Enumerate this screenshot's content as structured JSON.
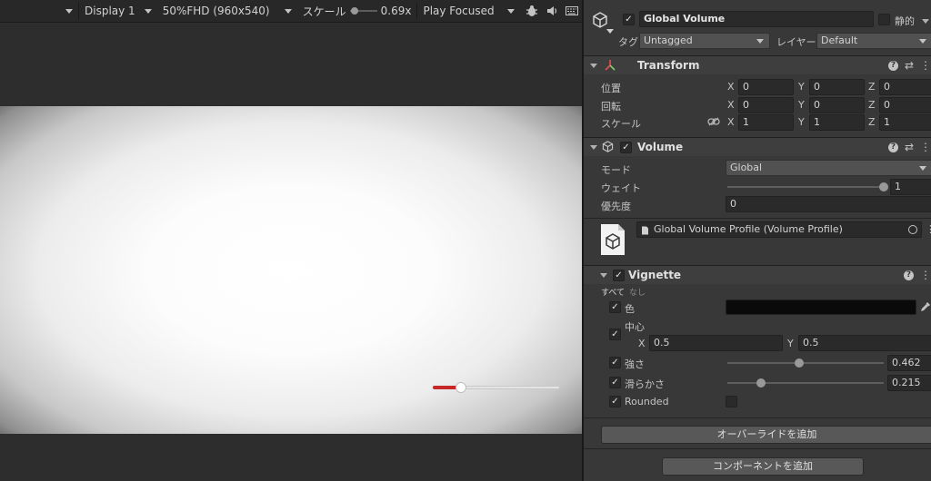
{
  "game_toolbar": {
    "display": "Display 1",
    "resolution": "50%FHD (960x540)",
    "scale_label": "スケール",
    "scale_value": "0.69x",
    "play_mode": "Play Focused",
    "icons": [
      "bug-icon",
      "speaker-icon",
      "keyboard-icon"
    ]
  },
  "game_view": {
    "health_bar_fill_fraction": 0.22,
    "health_bar_color": "#c62828"
  },
  "object_header": {
    "name": "Global Volume",
    "enabled": true,
    "static_label": "静的",
    "static": false,
    "tag_label": "タグ",
    "tag_value": "Untagged",
    "layer_label": "レイヤー",
    "layer_value": "Default"
  },
  "transform": {
    "title": "Transform",
    "position_label": "位置",
    "rotation_label": "回転",
    "scale_label": "スケール",
    "axes": [
      "X",
      "Y",
      "Z"
    ],
    "position": [
      "0",
      "0",
      "0"
    ],
    "rotation": [
      "0",
      "0",
      "0"
    ],
    "scale": [
      "1",
      "1",
      "1"
    ]
  },
  "volume": {
    "title": "Volume",
    "mode_label": "モード",
    "mode_value": "Global",
    "weight_label": "ウェイト",
    "weight_value": "1",
    "weight_fraction": 1,
    "priority_label": "優先度",
    "priority_value": "0",
    "profile_value": "Global Volume Profile (Volume Profile)"
  },
  "vignette": {
    "title": "Vignette",
    "all_label": "すべて",
    "none_label": "なし",
    "color_label": "色",
    "color_value": "#0a0a0a",
    "center_label": "中心",
    "center_x_label": "X",
    "center_x": "0.5",
    "center_y_label": "Y",
    "center_y": "0.5",
    "intensity_label": "強さ",
    "intensity_value": "0.462",
    "intensity_fraction": 0.462,
    "smoothness_label": "滑らかさ",
    "smoothness_value": "0.215",
    "smoothness_fraction": 0.215,
    "rounded_label": "Rounded",
    "rounded": false
  },
  "buttons": {
    "add_override": "オーバーライドを追加",
    "add_component": "コンポーネントを追加"
  }
}
